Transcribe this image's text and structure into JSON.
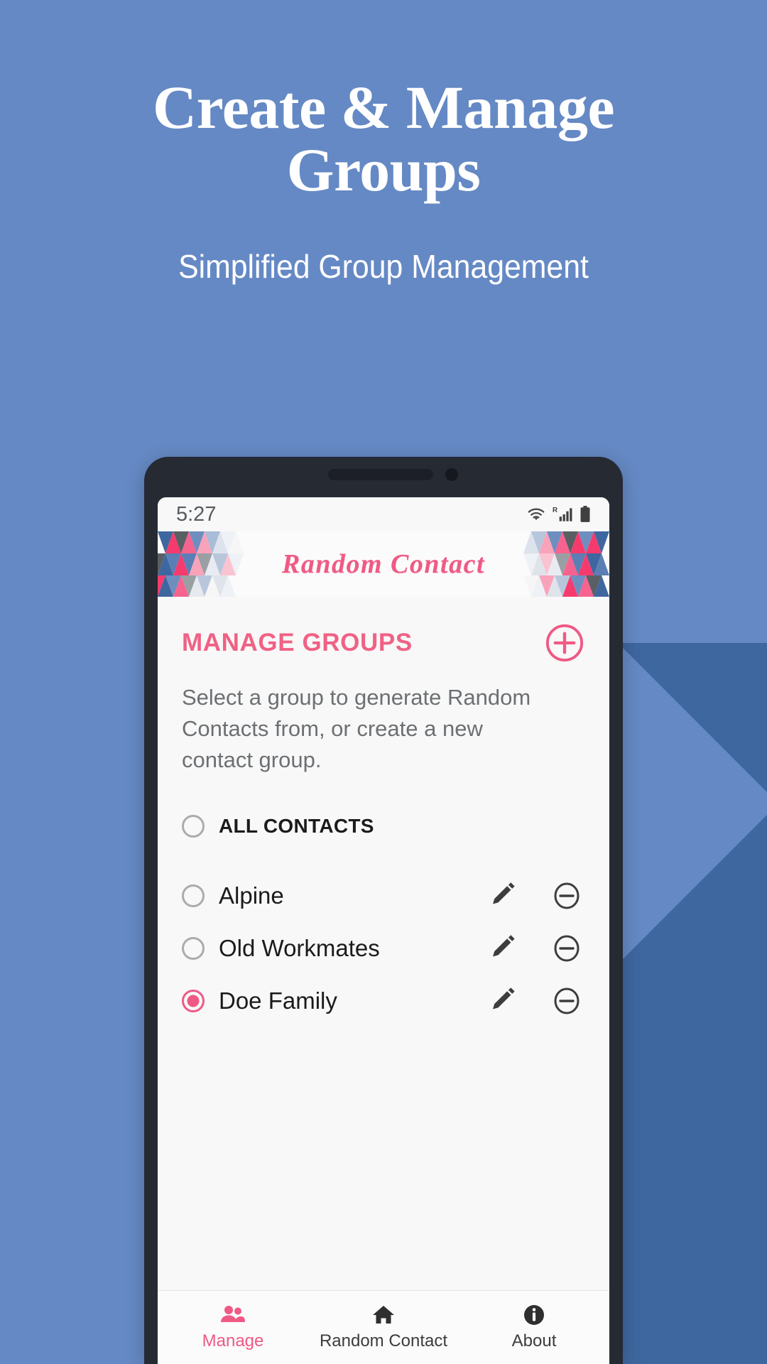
{
  "promo": {
    "headline_line1": "Create & Manage",
    "headline_line2": "Groups",
    "subtitle": "Simplified Group Management",
    "background_color": "#6589c4",
    "background_accent_color": "#3f679f"
  },
  "phone": {
    "status_bar": {
      "time": "5:27",
      "icons": [
        "wifi-icon",
        "signal-roaming-icon",
        "battery-icon"
      ]
    },
    "app_header": {
      "logo_text": "Random Contact",
      "logo_color": "#ef5a85",
      "pattern": "triangle-mosaic"
    },
    "screen": {
      "section_title": "MANAGE GROUPS",
      "add_button_icon": "plus-circle-icon",
      "accent_color": "#ef5a85",
      "description": "Select a group to generate Random Contacts from, or create a new contact group.",
      "groups": [
        {
          "label": "ALL CONTACTS",
          "selected": false,
          "emphasis": true,
          "has_actions": false
        },
        {
          "label": "Alpine",
          "selected": false,
          "emphasis": false,
          "has_actions": true
        },
        {
          "label": "Old Workmates",
          "selected": false,
          "emphasis": false,
          "has_actions": true
        },
        {
          "label": "Doe Family",
          "selected": true,
          "emphasis": false,
          "has_actions": true
        }
      ],
      "row_action_icons": {
        "edit": "pencil-icon",
        "remove": "minus-circle-icon"
      }
    },
    "bottom_nav": {
      "items": [
        {
          "label": "Manage",
          "icon": "people-icon",
          "active": true
        },
        {
          "label": "Random Contact",
          "icon": "home-icon",
          "active": false
        },
        {
          "label": "About",
          "icon": "info-icon",
          "active": false
        }
      ]
    }
  }
}
